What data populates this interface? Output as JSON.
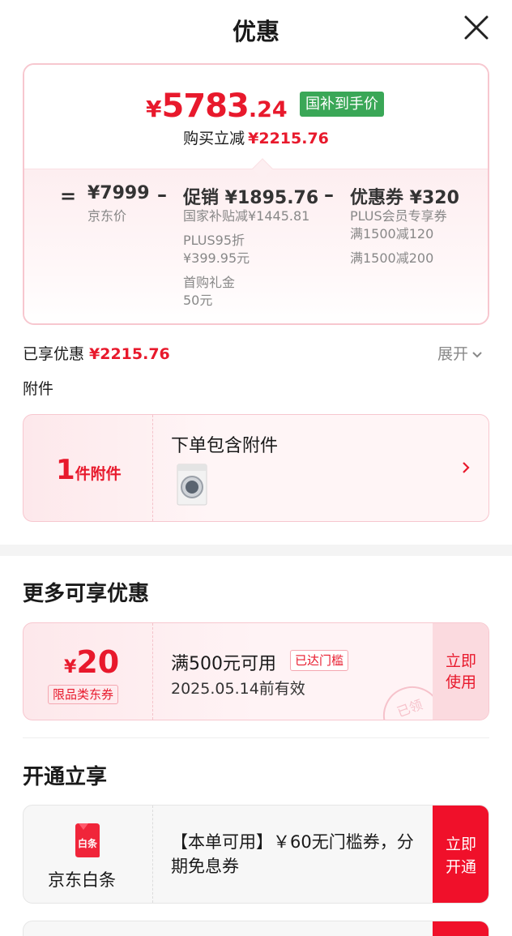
{
  "header": {
    "title": "优惠"
  },
  "price": {
    "currency": "¥",
    "integer": "5783",
    "decimal": ".24",
    "badge": "国补到手价",
    "reduce_label": "购买立减",
    "reduce_value": "¥2215.76"
  },
  "breakdown": {
    "eq": "=",
    "minus1": "–",
    "minus2": "–",
    "base": {
      "title": "¥7999",
      "label": "京东价"
    },
    "promo": {
      "title": "促销 ¥1895.76",
      "items": [
        "国家补贴减¥1445.81",
        "PLUS95折",
        "¥399.95元",
        "首购礼金",
        "50元"
      ]
    },
    "coupon": {
      "title": "优惠券 ¥320",
      "items": [
        "PLUS会员专享券",
        "满1500减120",
        "满1500减200"
      ]
    }
  },
  "summary": {
    "label": "已享优惠",
    "value": "¥2215.76",
    "expand": "展开"
  },
  "accessory": {
    "section": "附件",
    "count": "1",
    "unit": "件附件",
    "title": "下单包含附件"
  },
  "more": {
    "title": "更多可享优惠",
    "coupon": {
      "currency": "¥",
      "value": "20",
      "type": "限品类东券",
      "condition": "满500元可用",
      "tag": "已达门槛",
      "date": "2025.05.14前有效",
      "stamp": "已领",
      "action_line1": "立即",
      "action_line2": "使用"
    }
  },
  "open": {
    "title": "开通立享",
    "baitiao": {
      "icon_text": "白条",
      "name": "京东白条",
      "desc": "【本单可用】￥60无门槛券，分期免息券",
      "action_line1": "立即",
      "action_line2": "开通"
    }
  },
  "colors": {
    "accent": "#e8192c",
    "green_badge": "#3aa757",
    "button_red": "#f0102a"
  }
}
